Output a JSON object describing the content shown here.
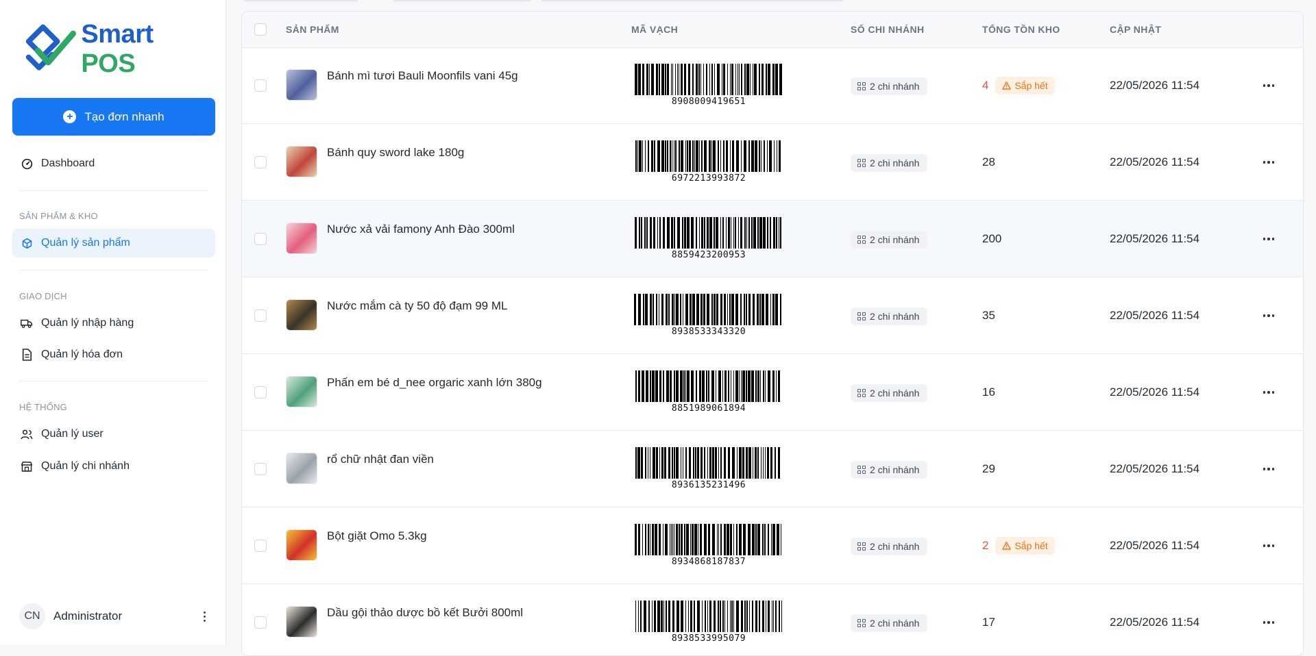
{
  "app": {
    "logo_smart": "Smart",
    "logo_pos": "POS"
  },
  "sidebar": {
    "quick_order_label": "Tạo đơn nhanh",
    "dashboard_label": "Dashboard",
    "sections": [
      {
        "title": "SẢN PHẨM & KHO",
        "items": [
          {
            "label": "Quản lý sản phẩm",
            "active": true
          }
        ]
      },
      {
        "title": "GIAO DỊCH",
        "items": [
          {
            "label": "Quản lý nhập hàng"
          },
          {
            "label": "Quản lý hóa đơn"
          }
        ]
      },
      {
        "title": "HỆ THỐNG",
        "items": [
          {
            "label": "Quản lý user"
          },
          {
            "label": "Quản lý chi nhánh"
          }
        ]
      }
    ],
    "user": {
      "initials": "CN",
      "name": "Administrator"
    }
  },
  "table": {
    "columns": [
      "SẢN PHẨM",
      "MÃ VẠCH",
      "SỐ CHI NHÁNH",
      "TỔNG TỒN KHO",
      "CẬP NHẬT"
    ],
    "low_stock_label": "Sắp hết",
    "rows": [
      {
        "name": "Bánh mì tươi Bauli Moonfils vani 45g",
        "barcode": "8908009419651",
        "branches": "2 chi nhánh",
        "stock": "4",
        "low": true,
        "updated": "22/05/2026 11:54",
        "thumb_colors": [
          "#4f5f9c",
          "#b9c2dc"
        ]
      },
      {
        "name": "Bánh quy sword lake 180g",
        "barcode": "6972213993872",
        "branches": "2 chi nhánh",
        "stock": "28",
        "low": false,
        "updated": "22/05/2026 11:54",
        "thumb_colors": [
          "#c0453a",
          "#e8d2b0"
        ]
      },
      {
        "name": "Nước xả vải famony Anh Đào 300ml",
        "barcode": "8859423200953",
        "branches": "2 chi nhánh",
        "stock": "200",
        "low": false,
        "updated": "22/05/2026 11:54",
        "thumb_colors": [
          "#e35f7d",
          "#f4d3da"
        ]
      },
      {
        "name": "Nước mắm cà ty 50 độ đạm 99 ML",
        "barcode": "8938533343320",
        "branches": "2 chi nhánh",
        "stock": "35",
        "low": false,
        "updated": "22/05/2026 11:54",
        "thumb_colors": [
          "#3a3328",
          "#b38a4a"
        ]
      },
      {
        "name": "Phấn em bé d_nee orgaric xanh lớn 380g",
        "barcode": "8851989061894",
        "branches": "2 chi nhánh",
        "stock": "16",
        "low": false,
        "updated": "22/05/2026 11:54",
        "thumb_colors": [
          "#4fa07a",
          "#d6e9da"
        ]
      },
      {
        "name": "rổ chữ nhật đan viền",
        "barcode": "8936135231496",
        "branches": "2 chi nhánh",
        "stock": "29",
        "low": false,
        "updated": "22/05/2026 11:54",
        "thumb_colors": [
          "#9aa1aa",
          "#e7e9ec"
        ]
      },
      {
        "name": "Bột giặt Omo 5.3kg",
        "barcode": "8934868187837",
        "branches": "2 chi nhánh",
        "stock": "2",
        "low": true,
        "updated": "22/05/2026 11:54",
        "thumb_colors": [
          "#d1322b",
          "#f2c230"
        ]
      },
      {
        "name": "Dầu gội thảo dược bồ kết Bưởi 800ml",
        "barcode": "8938533995079",
        "branches": "2 chi nhánh",
        "stock": "17",
        "low": false,
        "updated": "22/05/2026 11:54",
        "thumb_colors": [
          "#2c2c2c",
          "#e9e4d8"
        ]
      }
    ]
  },
  "colors": {
    "primary": "#1877f2",
    "logo_blue": "#1f5fc8",
    "logo_green": "#2fa865",
    "low_stock_text": "#e5533d",
    "low_badge_bg": "#fff0e2"
  }
}
